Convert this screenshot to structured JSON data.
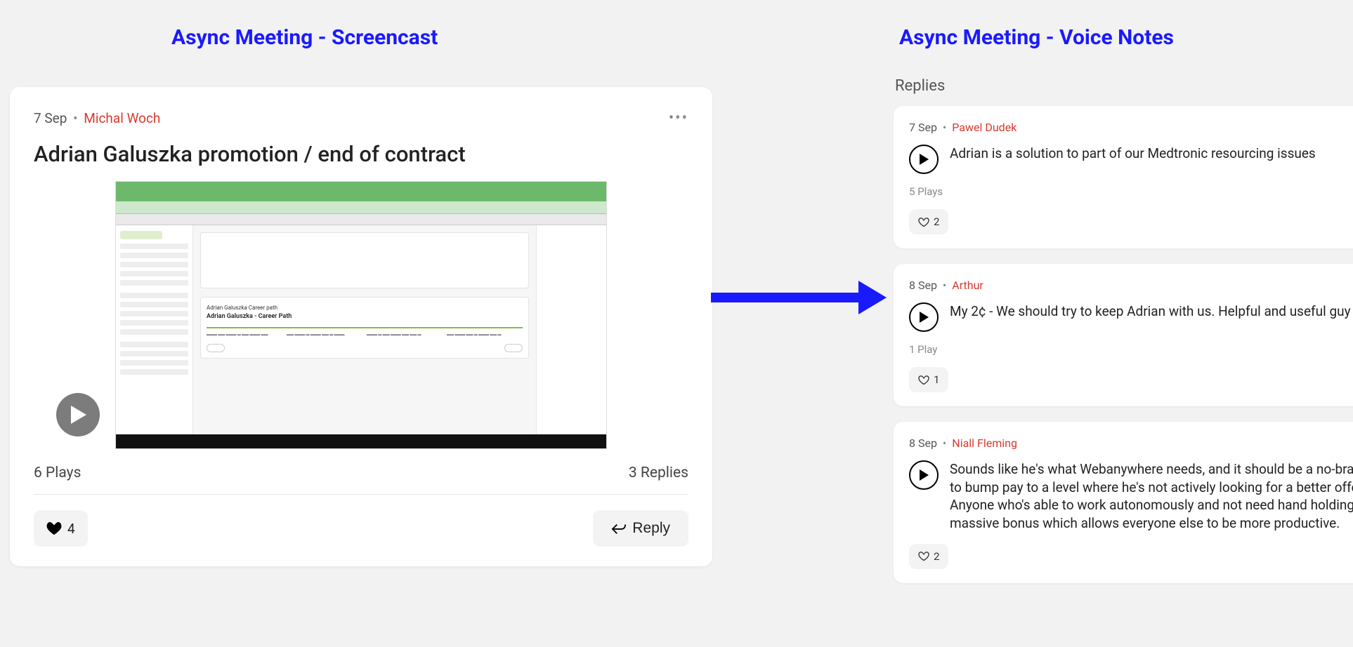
{
  "headings": {
    "left": "Async Meeting - Screencast",
    "right": "Async Meeting - Voice Notes"
  },
  "post": {
    "date": "7 Sep",
    "author": "Michal Woch",
    "title": "Adrian Galuszka promotion / end of contract",
    "plays": "6 Plays",
    "replies_count": "3 Replies",
    "like_count": "4",
    "reply_label": "Reply",
    "thumbnail": {
      "inner_title": "Adrian Galuszka Career path",
      "inner_subtitle": "Adrian Galuszka - Career Path"
    }
  },
  "replies_label": "Replies",
  "replies": [
    {
      "date": "7 Sep",
      "author": "Pawel Dudek",
      "text": "Adrian is a solution to part of our Medtronic resourcing issues",
      "plays": "5 Plays",
      "likes": "2"
    },
    {
      "date": "8 Sep",
      "author": "Arthur",
      "text": "My 2¢ - We should try to keep Adrian with us. Helpful and useful guy",
      "plays": "1 Play",
      "likes": "1"
    },
    {
      "date": "8 Sep",
      "author": "Niall Fleming",
      "text": "Sounds like he's what Webanywhere needs, and it should be a no-brainer to bump pay to a level where he's not actively looking for a better offer. Anyone who's able to work autonomously and not need hand holding is a massive bonus which allows everyone else to be more productive.",
      "plays": "",
      "likes": "2"
    }
  ]
}
